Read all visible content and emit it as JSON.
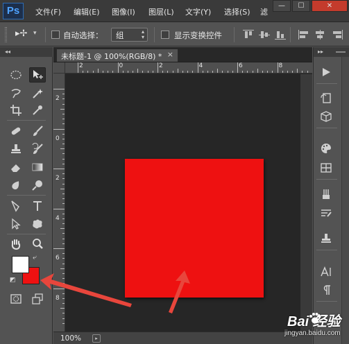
{
  "app": {
    "logo": "Ps"
  },
  "menu": {
    "items": [
      {
        "id": "file",
        "label": "文件(F)"
      },
      {
        "id": "edit",
        "label": "编辑(E)"
      },
      {
        "id": "image",
        "label": "图像(I)"
      },
      {
        "id": "layer",
        "label": "图层(L)"
      },
      {
        "id": "type",
        "label": "文字(Y)"
      },
      {
        "id": "select",
        "label": "选择(S)"
      },
      {
        "id": "filter",
        "label": "滤"
      }
    ]
  },
  "window_controls": {
    "minimize": "—",
    "restore": "☐",
    "close": "✕"
  },
  "options_bar": {
    "tool_icon": "move-tool-icon",
    "auto_select_label": "自动选择：",
    "auto_select_checked": false,
    "auto_select_target": "组",
    "show_transform_label": "显示变换控件",
    "show_transform_checked": false
  },
  "toolbar": {
    "collapse_label": "◂◂",
    "tools": [
      "marquee-tool-icon",
      "move-tool-icon",
      "lasso-tool-icon",
      "magic-wand-tool-icon",
      "crop-tool-icon",
      "eyedropper-tool-icon",
      "healing-brush-tool-icon",
      "brush-tool-icon",
      "clone-stamp-tool-icon",
      "history-brush-tool-icon",
      "eraser-tool-icon",
      "gradient-tool-icon",
      "blur-tool-icon",
      "dodge-tool-icon",
      "pen-tool-icon",
      "type-tool-icon",
      "path-selection-tool-icon",
      "custom-shape-tool-icon",
      "hand-tool-icon",
      "zoom-tool-icon"
    ],
    "foreground_color": "#ffffff",
    "background_color": "#ee1111"
  },
  "document": {
    "tab_title": "未标题-1 @ 100%(RGB/8) *",
    "tab_close": "×",
    "zoom": "100%",
    "canvas_color": "#ee1111",
    "ruler_h_labels": [
      "2",
      "0",
      "2",
      "4",
      "6",
      "8"
    ],
    "ruler_v_labels": [
      "2",
      "0",
      "2",
      "4",
      "6",
      "8"
    ]
  },
  "right_panel": {
    "collapse_label": "▸▸",
    "buttons": [
      "play-icon",
      "history-icon",
      "3d-icon",
      "swatches-icon",
      "grid-icon",
      "brushes-icon",
      "brush-presets-icon",
      "clone-source-icon",
      "character-icon",
      "paragraph-icon"
    ]
  },
  "annotation": {
    "arrow_color": "#e8463c"
  },
  "watermark": {
    "brand": "Bai  经验",
    "url": "jingyan.baidu.com"
  }
}
